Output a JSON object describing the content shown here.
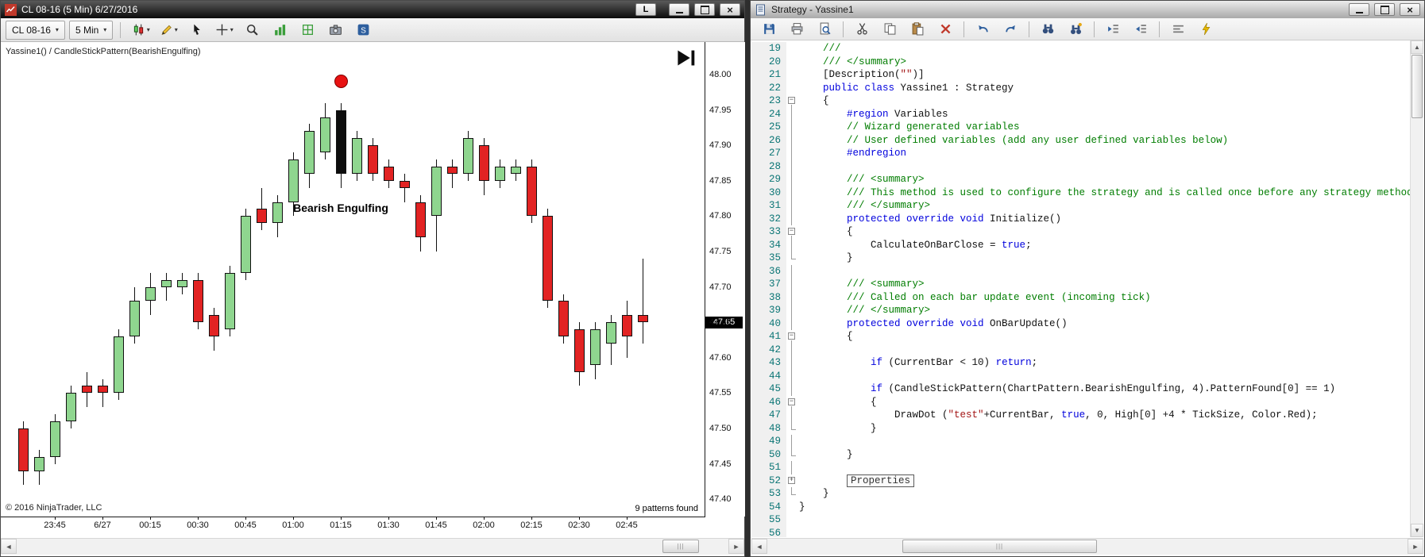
{
  "glyphs": {
    "dropdown": "▾",
    "close": "×",
    "scroll_left": "◄",
    "scroll_right": "►",
    "scroll_up": "▲",
    "scroll_down": "▼",
    "grip_h": "|||"
  },
  "left_window": {
    "title": "CL 08-16 (5 Min)  6/27/2016",
    "link_button_label": "L",
    "toolbar": {
      "instrument_label": "CL 08-16",
      "interval_label": "5 Min",
      "icons": [
        {
          "name": "chart-style",
          "dropdown": true
        },
        {
          "name": "drawing-tools",
          "dropdown": true
        },
        {
          "name": "cursor",
          "dropdown": false
        },
        {
          "name": "crosshair",
          "dropdown": true
        },
        {
          "name": "zoom",
          "dropdown": false
        },
        {
          "name": "data-series",
          "dropdown": false
        },
        {
          "name": "grid",
          "dropdown": false
        },
        {
          "name": "snapshot",
          "dropdown": false
        },
        {
          "name": "strategy",
          "dropdown": false
        }
      ]
    },
    "chart": {
      "label": "Yassine1() / CandleStickPattern(BearishEngulfing)",
      "copyright": "© 2016 NinjaTrader, LLC",
      "patterns_found": "9 patterns found",
      "price_marker": "47.65"
    }
  },
  "chart_data": {
    "type": "candlestick",
    "instrument": "CL 08-16",
    "interval": "5 Min",
    "ylim": [
      47.4,
      48.0
    ],
    "y_ticks": [
      "48.00",
      "47.95",
      "47.90",
      "47.85",
      "47.80",
      "47.75",
      "47.70",
      "47.65",
      "47.60",
      "47.55",
      "47.50",
      "47.45",
      "47.40"
    ],
    "x_labels": [
      {
        "text": "23:45",
        "bar": 2
      },
      {
        "text": "6/27",
        "bar": 5
      },
      {
        "text": "00:15",
        "bar": 8
      },
      {
        "text": "00:30",
        "bar": 11
      },
      {
        "text": "00:45",
        "bar": 14
      },
      {
        "text": "01:00",
        "bar": 17
      },
      {
        "text": "01:15",
        "bar": 20
      },
      {
        "text": "01:30",
        "bar": 23
      },
      {
        "text": "01:45",
        "bar": 26
      },
      {
        "text": "02:00",
        "bar": 29
      },
      {
        "text": "02:15",
        "bar": 32
      },
      {
        "text": "02:30",
        "bar": 35
      },
      {
        "text": "02:45",
        "bar": 38
      }
    ],
    "candles": [
      {
        "o": 47.5,
        "h": 47.51,
        "l": 47.42,
        "c": 47.44,
        "k": "d"
      },
      {
        "o": 47.44,
        "h": 47.47,
        "l": 47.42,
        "c": 47.46,
        "k": "u"
      },
      {
        "o": 47.46,
        "h": 47.52,
        "l": 47.45,
        "c": 47.51,
        "k": "u"
      },
      {
        "o": 47.51,
        "h": 47.56,
        "l": 47.5,
        "c": 47.55,
        "k": "u"
      },
      {
        "o": 47.56,
        "h": 47.58,
        "l": 47.53,
        "c": 47.55,
        "k": "d"
      },
      {
        "o": 47.56,
        "h": 47.57,
        "l": 47.53,
        "c": 47.55,
        "k": "d"
      },
      {
        "o": 47.55,
        "h": 47.64,
        "l": 47.54,
        "c": 47.63,
        "k": "u"
      },
      {
        "o": 47.63,
        "h": 47.7,
        "l": 47.62,
        "c": 47.68,
        "k": "u"
      },
      {
        "o": 47.68,
        "h": 47.72,
        "l": 47.66,
        "c": 47.7,
        "k": "u"
      },
      {
        "o": 47.7,
        "h": 47.72,
        "l": 47.68,
        "c": 47.71,
        "k": "u"
      },
      {
        "o": 47.7,
        "h": 47.72,
        "l": 47.69,
        "c": 47.71,
        "k": "u"
      },
      {
        "o": 47.71,
        "h": 47.72,
        "l": 47.64,
        "c": 47.65,
        "k": "d"
      },
      {
        "o": 47.66,
        "h": 47.67,
        "l": 47.61,
        "c": 47.63,
        "k": "d"
      },
      {
        "o": 47.64,
        "h": 47.73,
        "l": 47.63,
        "c": 47.72,
        "k": "u"
      },
      {
        "o": 47.72,
        "h": 47.81,
        "l": 47.71,
        "c": 47.8,
        "k": "u"
      },
      {
        "o": 47.81,
        "h": 47.84,
        "l": 47.78,
        "c": 47.79,
        "k": "d"
      },
      {
        "o": 47.79,
        "h": 47.83,
        "l": 47.77,
        "c": 47.82,
        "k": "u"
      },
      {
        "o": 47.82,
        "h": 47.89,
        "l": 47.8,
        "c": 47.88,
        "k": "u"
      },
      {
        "o": 47.86,
        "h": 47.93,
        "l": 47.84,
        "c": 47.92,
        "k": "u"
      },
      {
        "o": 47.89,
        "h": 47.96,
        "l": 47.88,
        "c": 47.94,
        "k": "u"
      },
      {
        "o": 47.95,
        "h": 47.96,
        "l": 47.84,
        "c": 47.86,
        "k": "b"
      },
      {
        "o": 47.86,
        "h": 47.92,
        "l": 47.85,
        "c": 47.91,
        "k": "u"
      },
      {
        "o": 47.9,
        "h": 47.91,
        "l": 47.85,
        "c": 47.86,
        "k": "d"
      },
      {
        "o": 47.87,
        "h": 47.88,
        "l": 47.84,
        "c": 47.85,
        "k": "d"
      },
      {
        "o": 47.85,
        "h": 47.86,
        "l": 47.82,
        "c": 47.84,
        "k": "d"
      },
      {
        "o": 47.82,
        "h": 47.83,
        "l": 47.75,
        "c": 47.77,
        "k": "d"
      },
      {
        "o": 47.8,
        "h": 47.88,
        "l": 47.75,
        "c": 47.87,
        "k": "u"
      },
      {
        "o": 47.87,
        "h": 47.88,
        "l": 47.84,
        "c": 47.86,
        "k": "d"
      },
      {
        "o": 47.86,
        "h": 47.92,
        "l": 47.85,
        "c": 47.91,
        "k": "u"
      },
      {
        "o": 47.9,
        "h": 47.91,
        "l": 47.83,
        "c": 47.85,
        "k": "d"
      },
      {
        "o": 47.85,
        "h": 47.88,
        "l": 47.84,
        "c": 47.87,
        "k": "u"
      },
      {
        "o": 47.86,
        "h": 47.88,
        "l": 47.85,
        "c": 47.87,
        "k": "u"
      },
      {
        "o": 47.87,
        "h": 47.88,
        "l": 47.79,
        "c": 47.8,
        "k": "d"
      },
      {
        "o": 47.8,
        "h": 47.81,
        "l": 47.67,
        "c": 47.68,
        "k": "d"
      },
      {
        "o": 47.68,
        "h": 47.69,
        "l": 47.62,
        "c": 47.63,
        "k": "d"
      },
      {
        "o": 47.64,
        "h": 47.65,
        "l": 47.56,
        "c": 47.58,
        "k": "d"
      },
      {
        "o": 47.59,
        "h": 47.65,
        "l": 47.57,
        "c": 47.64,
        "k": "u"
      },
      {
        "o": 47.62,
        "h": 47.66,
        "l": 47.59,
        "c": 47.65,
        "k": "u"
      },
      {
        "o": 47.66,
        "h": 47.68,
        "l": 47.6,
        "c": 47.63,
        "k": "d"
      },
      {
        "o": 47.66,
        "h": 47.74,
        "l": 47.62,
        "c": 47.65,
        "k": "d"
      }
    ],
    "marker_dot": {
      "bar": 20,
      "price": 47.99,
      "color": "#e81212"
    },
    "annotation": {
      "text": "Bearish Engulfing",
      "bar": 20,
      "price": 47.81
    },
    "last_price": 47.65,
    "status_note": "9 patterns found"
  },
  "right_window": {
    "title": "Strategy - Yassine1",
    "toolbar_icons": [
      {
        "name": "save"
      },
      {
        "name": "print"
      },
      {
        "name": "page-find"
      },
      {
        "name": "sep"
      },
      {
        "name": "cut"
      },
      {
        "name": "copy"
      },
      {
        "name": "paste"
      },
      {
        "name": "delete"
      },
      {
        "name": "sep"
      },
      {
        "name": "undo"
      },
      {
        "name": "redo"
      },
      {
        "name": "sep"
      },
      {
        "name": "find"
      },
      {
        "name": "replace"
      },
      {
        "name": "sep"
      },
      {
        "name": "indent"
      },
      {
        "name": "outdent"
      },
      {
        "name": "sep"
      },
      {
        "name": "align"
      },
      {
        "name": "run"
      }
    ],
    "editor": {
      "lines": [
        {
          "num": 19,
          "fold": "",
          "seg": [
            {
              "t": "    ///",
              "c": "c"
            }
          ]
        },
        {
          "num": 20,
          "fold": "",
          "seg": [
            {
              "t": "    /// </summary>",
              "c": "c"
            }
          ]
        },
        {
          "num": 21,
          "fold": "",
          "seg": [
            {
              "t": "    [Description(",
              "c": "p"
            },
            {
              "t": "\"\"",
              "c": "s"
            },
            {
              "t": ")]",
              "c": "p"
            }
          ]
        },
        {
          "num": 22,
          "fold": "",
          "seg": [
            {
              "t": "    ",
              "c": "p"
            },
            {
              "t": "public class",
              "c": "k"
            },
            {
              "t": " Yassine1 : Strategy",
              "c": "p"
            }
          ]
        },
        {
          "num": 23,
          "fold": "open",
          "seg": [
            {
              "t": "    {",
              "c": "p"
            }
          ]
        },
        {
          "num": 24,
          "fold": "line",
          "seg": [
            {
              "t": "        ",
              "c": "p"
            },
            {
              "t": "#region",
              "c": "k"
            },
            {
              "t": " Variables",
              "c": "p"
            }
          ]
        },
        {
          "num": 25,
          "fold": "line",
          "seg": [
            {
              "t": "        // Wizard generated variables",
              "c": "c"
            }
          ]
        },
        {
          "num": 26,
          "fold": "line",
          "seg": [
            {
              "t": "        // User defined variables (add any user defined variables below)",
              "c": "c"
            }
          ]
        },
        {
          "num": 27,
          "fold": "line",
          "seg": [
            {
              "t": "        ",
              "c": "p"
            },
            {
              "t": "#endregion",
              "c": "k"
            }
          ]
        },
        {
          "num": 28,
          "fold": "line",
          "seg": []
        },
        {
          "num": 29,
          "fold": "line",
          "seg": [
            {
              "t": "        /// <summary>",
              "c": "c"
            }
          ]
        },
        {
          "num": 30,
          "fold": "line",
          "seg": [
            {
              "t": "        /// This method is used to configure the strategy and is called once before any strategy method is called.",
              "c": "c"
            }
          ]
        },
        {
          "num": 31,
          "fold": "line",
          "seg": [
            {
              "t": "        /// </summary>",
              "c": "c"
            }
          ]
        },
        {
          "num": 32,
          "fold": "line",
          "seg": [
            {
              "t": "        ",
              "c": "p"
            },
            {
              "t": "protected override void",
              "c": "k"
            },
            {
              "t": " Initialize()",
              "c": "p"
            }
          ]
        },
        {
          "num": 33,
          "fold": "open",
          "seg": [
            {
              "t": "        {",
              "c": "p"
            }
          ]
        },
        {
          "num": 34,
          "fold": "line",
          "seg": [
            {
              "t": "            CalculateOnBarClose = ",
              "c": "p"
            },
            {
              "t": "true",
              "c": "k"
            },
            {
              "t": ";",
              "c": "p"
            }
          ]
        },
        {
          "num": 35,
          "fold": "end",
          "seg": [
            {
              "t": "        }",
              "c": "p"
            }
          ]
        },
        {
          "num": 36,
          "fold": "line",
          "seg": []
        },
        {
          "num": 37,
          "fold": "line",
          "seg": [
            {
              "t": "        /// <summary>",
              "c": "c"
            }
          ]
        },
        {
          "num": 38,
          "fold": "line",
          "seg": [
            {
              "t": "        /// Called on each bar update event (incoming tick)",
              "c": "c"
            }
          ]
        },
        {
          "num": 39,
          "fold": "line",
          "seg": [
            {
              "t": "        /// </summary>",
              "c": "c"
            }
          ]
        },
        {
          "num": 40,
          "fold": "line",
          "seg": [
            {
              "t": "        ",
              "c": "p"
            },
            {
              "t": "protected override void",
              "c": "k"
            },
            {
              "t": " OnBarUpdate()",
              "c": "p"
            }
          ]
        },
        {
          "num": 41,
          "fold": "open",
          "seg": [
            {
              "t": "        {",
              "c": "p"
            }
          ]
        },
        {
          "num": 42,
          "fold": "line",
          "seg": []
        },
        {
          "num": 43,
          "fold": "line",
          "seg": [
            {
              "t": "            ",
              "c": "p"
            },
            {
              "t": "if",
              "c": "k"
            },
            {
              "t": " (CurrentBar < 10) ",
              "c": "p"
            },
            {
              "t": "return",
              "c": "k"
            },
            {
              "t": ";",
              "c": "p"
            }
          ]
        },
        {
          "num": 44,
          "fold": "line",
          "seg": []
        },
        {
          "num": 45,
          "fold": "line",
          "seg": [
            {
              "t": "            ",
              "c": "p"
            },
            {
              "t": "if",
              "c": "k"
            },
            {
              "t": " (CandleStickPattern(ChartPattern.BearishEngulfing, 4).PatternFound[0] == 1)",
              "c": "p"
            }
          ]
        },
        {
          "num": 46,
          "fold": "open",
          "seg": [
            {
              "t": "            {",
              "c": "p"
            }
          ]
        },
        {
          "num": 47,
          "fold": "line",
          "seg": [
            {
              "t": "                DrawDot (",
              "c": "p"
            },
            {
              "t": "\"test\"",
              "c": "s"
            },
            {
              "t": "+CurrentBar, ",
              "c": "p"
            },
            {
              "t": "true",
              "c": "k"
            },
            {
              "t": ", 0, High[0] +4 * TickSize, Color.Red);",
              "c": "p"
            }
          ]
        },
        {
          "num": 48,
          "fold": "end",
          "seg": [
            {
              "t": "            }",
              "c": "p"
            }
          ]
        },
        {
          "num": 49,
          "fold": "line",
          "seg": []
        },
        {
          "num": 50,
          "fold": "end",
          "seg": [
            {
              "t": "        }",
              "c": "p"
            }
          ]
        },
        {
          "num": 51,
          "fold": "line",
          "seg": []
        },
        {
          "num": 52,
          "fold": "plus",
          "seg": [
            {
              "t": "        ",
              "c": "p"
            },
            {
              "t": "Properties",
              "c": "box"
            }
          ]
        },
        {
          "num": 53,
          "fold": "end",
          "seg": [
            {
              "t": "    }",
              "c": "p"
            }
          ]
        },
        {
          "num": 54,
          "fold": "",
          "seg": [
            {
              "t": "}",
              "c": "p"
            }
          ]
        },
        {
          "num": 55,
          "fold": "",
          "seg": []
        },
        {
          "num": 56,
          "fold": "",
          "seg": []
        }
      ]
    }
  }
}
